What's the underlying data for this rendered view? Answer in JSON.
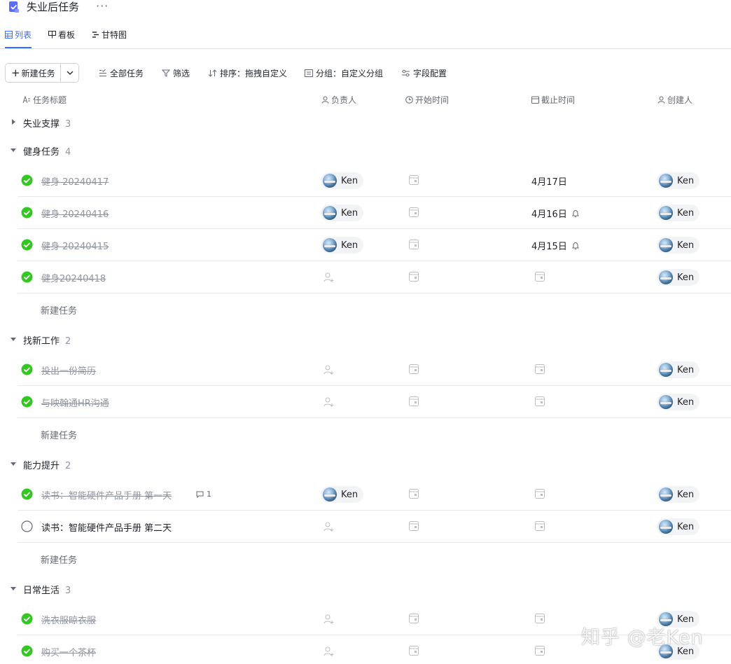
{
  "header": {
    "title": "失业后任务",
    "more": "···"
  },
  "tabs": [
    {
      "label": "列表",
      "icon": "table-icon",
      "active": true
    },
    {
      "label": "看板",
      "icon": "kanban-icon",
      "active": false
    },
    {
      "label": "甘特图",
      "icon": "gantt-icon",
      "active": false
    }
  ],
  "toolbar": {
    "new_task": "新建任务",
    "all_tasks": "全部任务",
    "filter": "筛选",
    "sort": "排序：拖拽自定义",
    "group": "分组：自定义分组",
    "fields": "字段配置"
  },
  "columns": {
    "title": "任务标题",
    "assignee": "负责人",
    "start": "开始时间",
    "due": "截止时间",
    "creator": "创建人"
  },
  "groups": {
    "g0": {
      "name": "失业支撑",
      "count": "3"
    },
    "g1": {
      "name": "健身任务",
      "count": "4"
    },
    "g2": {
      "name": "找新工作",
      "count": "2"
    },
    "g3": {
      "name": "能力提升",
      "count": "2"
    },
    "g4": {
      "name": "日常生活",
      "count": "3"
    }
  },
  "tasks": {
    "t1": {
      "name": "健身 20240417",
      "done": true,
      "assignee": "Ken",
      "due": "4月17日",
      "creator": "Ken"
    },
    "t2": {
      "name": "健身 20240416",
      "done": true,
      "assignee": "Ken",
      "due": "4月16日",
      "creator": "Ken"
    },
    "t3": {
      "name": "健身 20240415",
      "done": true,
      "assignee": "Ken",
      "due": "4月15日",
      "creator": "Ken"
    },
    "t4": {
      "name": "健身20240418",
      "done": true,
      "creator": "Ken"
    },
    "t5": {
      "name": "投出一份简历",
      "done": true,
      "creator": "Ken"
    },
    "t6": {
      "name": "与映翰通HR沟通",
      "done": true,
      "creator": "Ken"
    },
    "t7": {
      "name": "读书：智能硬件产品手册 第一天",
      "done": true,
      "assignee": "Ken",
      "comments": "1",
      "creator": "Ken"
    },
    "t8": {
      "name": "读书：智能硬件产品手册 第二天",
      "done": false,
      "creator": "Ken"
    },
    "t9": {
      "name": "洗衣服晾衣服",
      "done": true,
      "creator": "Ken"
    },
    "t10": {
      "name": "购买一个茶杯",
      "done": true,
      "creator": "Ken"
    }
  },
  "new_task_label": "新建任务",
  "watermark": "知乎 @老Ken",
  "colors": {
    "accent": "#3370ff",
    "done_green": "#34c724",
    "text": "#1f2329",
    "muted": "#8f959e"
  }
}
